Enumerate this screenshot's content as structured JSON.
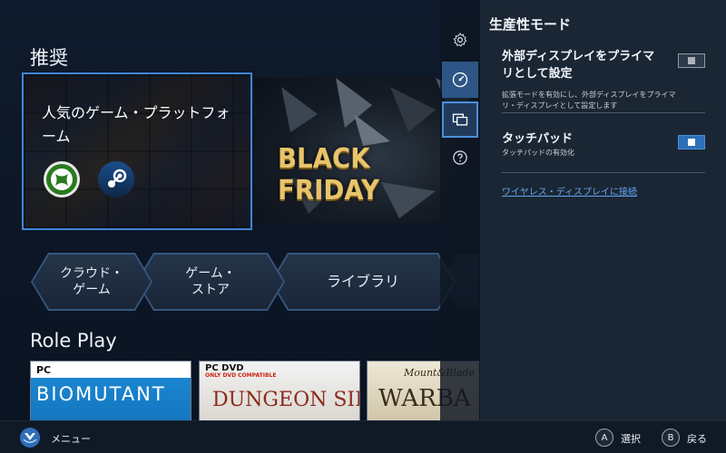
{
  "main": {
    "recommended_title": "推奨",
    "featured_label": "人気のゲーム・プラットフォーム",
    "black_friday_text": "BLACK FRIDAY",
    "nav": {
      "cloud": "クラウド・\nゲーム",
      "store": "ゲーム・\nストア",
      "library": "ライブラリ"
    },
    "roleplay_title": "Role Play",
    "cards": {
      "biomutant_platform": "PC",
      "biomutant_title": "BIOMUTANT",
      "dungeon_platform": "PC DVD",
      "dungeon_platform_sub": "ONLY DVD COMPATIBLE",
      "dungeon_title": "DUNGEON SIEGE",
      "warband_sub": "Mount&Blade",
      "warband_title": "WARBA"
    }
  },
  "rail": {
    "icons": [
      "gear-icon",
      "gauge-icon",
      "display-icon",
      "help-icon"
    ]
  },
  "panel": {
    "title": "生産性モード",
    "external_display_label": "外部ディスプレイをプライマリとして設定",
    "external_display_desc": "拡張モードを有効にし、外部ディスプレイをプライマリ・ディスプレイとして設定します",
    "external_display_on": false,
    "touchpad_label": "タッチパッド",
    "touchpad_desc": "タッチパッドの有効化",
    "touchpad_on": true,
    "wireless_link": "ワイヤレス・ディスプレイに接続"
  },
  "bottombar": {
    "menu_label": "メニュー",
    "a_key": "A",
    "a_label": "選択",
    "b_key": "B",
    "b_label": "戻る"
  },
  "colors": {
    "accent": "#3f86d6",
    "panel_bg": "#1b2634",
    "link": "#62a6f0"
  }
}
